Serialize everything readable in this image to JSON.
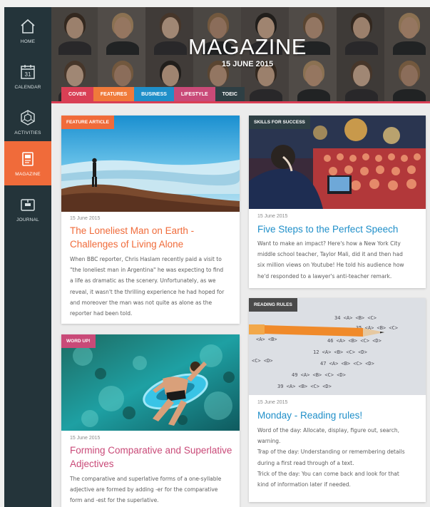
{
  "sidebar": {
    "items": [
      {
        "label": "Home",
        "icon": "home-icon"
      },
      {
        "label": "Calendar",
        "icon": "calendar-icon",
        "icon_text": "31"
      },
      {
        "label": "Activities",
        "icon": "activities-icon"
      },
      {
        "label": "Magazine",
        "icon": "magazine-icon",
        "active": true
      },
      {
        "label": "Journal",
        "icon": "journal-icon"
      }
    ]
  },
  "header": {
    "title": "MAGAZINE",
    "date": "15 JUNE 2015",
    "tabs": [
      {
        "label": "Cover",
        "color": "#d93f55"
      },
      {
        "label": "Features",
        "color": "#f07a3a"
      },
      {
        "label": "Business",
        "color": "#1f8fc9"
      },
      {
        "label": "Lifestyle",
        "color": "#c94a78"
      },
      {
        "label": "Toeic",
        "color": "#2e3f44"
      }
    ],
    "accent_line_color": "#d93f55"
  },
  "cards": {
    "feature": {
      "badge": "Feature article",
      "badge_color": "#f06b3a",
      "date": "15 June 2015",
      "title_line1": "The Loneliest Man on Earth -",
      "title_line2": "Challenges of Living Alone",
      "title_color": "#f06b3a",
      "text": [
        "When BBC reporter, Chris Haslam recently paid a visit to",
        "\"the loneliest man in Argentina\" he was expecting to find",
        "a life as dramatic as the scenery. Unfortunately, as we",
        "reveal, it wasn't the thrilling experience he had hoped for",
        "and moreover the man was not quite as alone as the",
        "reporter had been told."
      ]
    },
    "skills": {
      "badge": "Skills for success",
      "badge_color": "#2e3f44",
      "date": "15 June 2015",
      "title_line1": "Five Steps to the Perfect Speech",
      "title_color": "#1f8fc9",
      "text": [
        "Want to make an impact? Here's how a New York City",
        "middle school teacher, Taylor Mali, did it and then had",
        "six million views on Youtube! He told his audience how",
        "he'd responded to a lawyer's anti-teacher remark."
      ]
    },
    "wordup": {
      "badge": "Word up!",
      "badge_color": "#c94a78",
      "date": "15 June 2015",
      "title_line1": "Forming Comparative and Superlative",
      "title_line2": "Adjectives",
      "title_color": "#c94a78",
      "text": [
        "The comparative and superlative forms of a one-syllable",
        "adjective are formed by adding -er for the comparative",
        "form and -est for the superlative."
      ]
    },
    "reading": {
      "badge": "Reading rules",
      "badge_color": "#4a4a4a",
      "date": "15 June 2015",
      "title_line1": "Monday - Reading rules!",
      "title_color": "#1f8fc9",
      "text": [
        "Word of the day: Allocate, display, figure out, search,",
        "warning.",
        "Trap of the day: Understanding or remembering details",
        "during a first read through of a text.",
        "Trick of the day: You can come back and look for that",
        "kind of information later if needed."
      ]
    }
  }
}
